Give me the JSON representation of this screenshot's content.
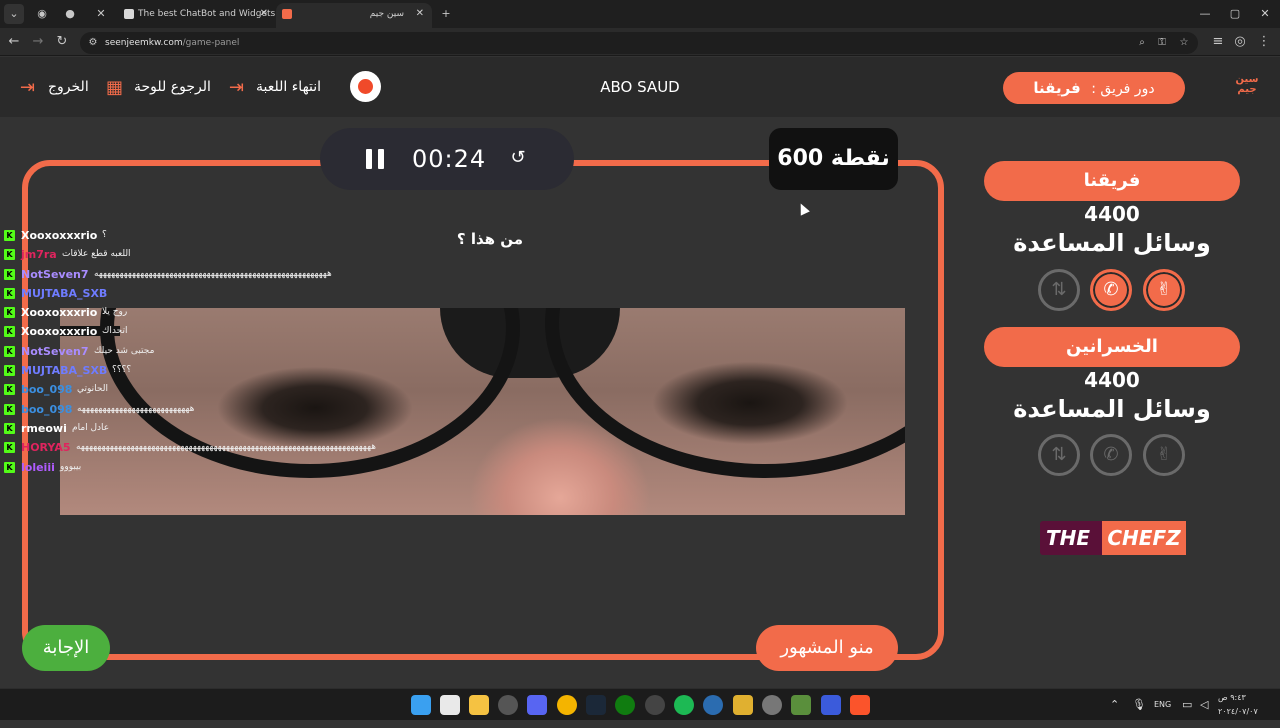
{
  "browser": {
    "tabs": [
      {
        "label": "The best ChatBot and Widgets"
      },
      {
        "label": "سين جيم"
      }
    ],
    "url_domain": "seenjeemkw.com",
    "url_path": "/game-panel"
  },
  "header": {
    "exit_label": "الخروج",
    "back_to_board_label": "الرجوع للوحة",
    "end_game_label": "انتهاء اللعبة",
    "player_name": "ABO SAUD",
    "turn_label": "دور فريق :",
    "turn_team": "فريقنا",
    "logo_text": "سين جيم"
  },
  "game": {
    "timer": "00:24",
    "points": "600 نقطة",
    "question": "من هذا ؟",
    "answer_button": "الإجابة",
    "category_button": "منو المشهور"
  },
  "chat": [
    {
      "user": "Xooxoxxxrio",
      "color": "#ffffff",
      "msg": "؟"
    },
    {
      "user": "jm7ra",
      "color": "#e0245e",
      "msg": "اللعبه قطع علاقات"
    },
    {
      "user": "NotSeven7",
      "color": "#a98cff",
      "msg": "ههههههههههههههههههههههههههههههههههههههههههههههههههههههههه"
    },
    {
      "user": "MUJTABA_SXB",
      "color": "#6f7cff",
      "msg": ""
    },
    {
      "user": "Xooxoxxxrio",
      "color": "#ffffff",
      "msg": "روح يلا"
    },
    {
      "user": "Xooxoxxxrio",
      "color": "#ffffff",
      "msg": "اتحداك"
    },
    {
      "user": "NotSeven7",
      "color": "#a98cff",
      "msg": "مجتبى شد حيلك"
    },
    {
      "user": "MUJTABA_SXB",
      "color": "#6f7cff",
      "msg": "؟؟؟؟"
    },
    {
      "user": "boo_098",
      "color": "#3b8fe0",
      "msg": "الحانوتي"
    },
    {
      "user": "boo_098",
      "color": "#3b8fe0",
      "msg": "هههههههههههههههههههههههههههه"
    },
    {
      "user": "rmeowi",
      "color": "#ffffff",
      "msg": "عادل امام"
    },
    {
      "user": "HORYA5",
      "color": "#e0245e",
      "msg": "هههههههههههههههههههههههههههههههههههههههههههههههههههههههههههههههههههههههه"
    },
    {
      "user": "loleiii",
      "color": "#b05cff",
      "msg": "بيبووو"
    }
  ],
  "teams": [
    {
      "name": "فريقنا",
      "score": "4400",
      "aids_label": "وسائل المساعدة",
      "aids": [
        {
          "icon": "two-fingers-icon",
          "active": true
        },
        {
          "icon": "phone-icon",
          "active": true
        },
        {
          "icon": "swap-icon",
          "active": false
        }
      ]
    },
    {
      "name": "الخسرانين",
      "score": "4400",
      "aids_label": "وسائل المساعدة",
      "aids": [
        {
          "icon": "two-fingers-icon",
          "active": false
        },
        {
          "icon": "phone-icon",
          "active": false
        },
        {
          "icon": "swap-icon",
          "active": false
        }
      ]
    }
  ],
  "sponsor": {
    "part1": "THE",
    "part2": "CHEFZ"
  },
  "taskbar": {
    "lang": "ENG",
    "time": "٩:٤٣ ص",
    "date": "٢٠٢٤/٠٧/٠٧"
  },
  "colors": {
    "accent": "#f26b4a",
    "answer": "#4caf3e",
    "bg": "#333333"
  }
}
